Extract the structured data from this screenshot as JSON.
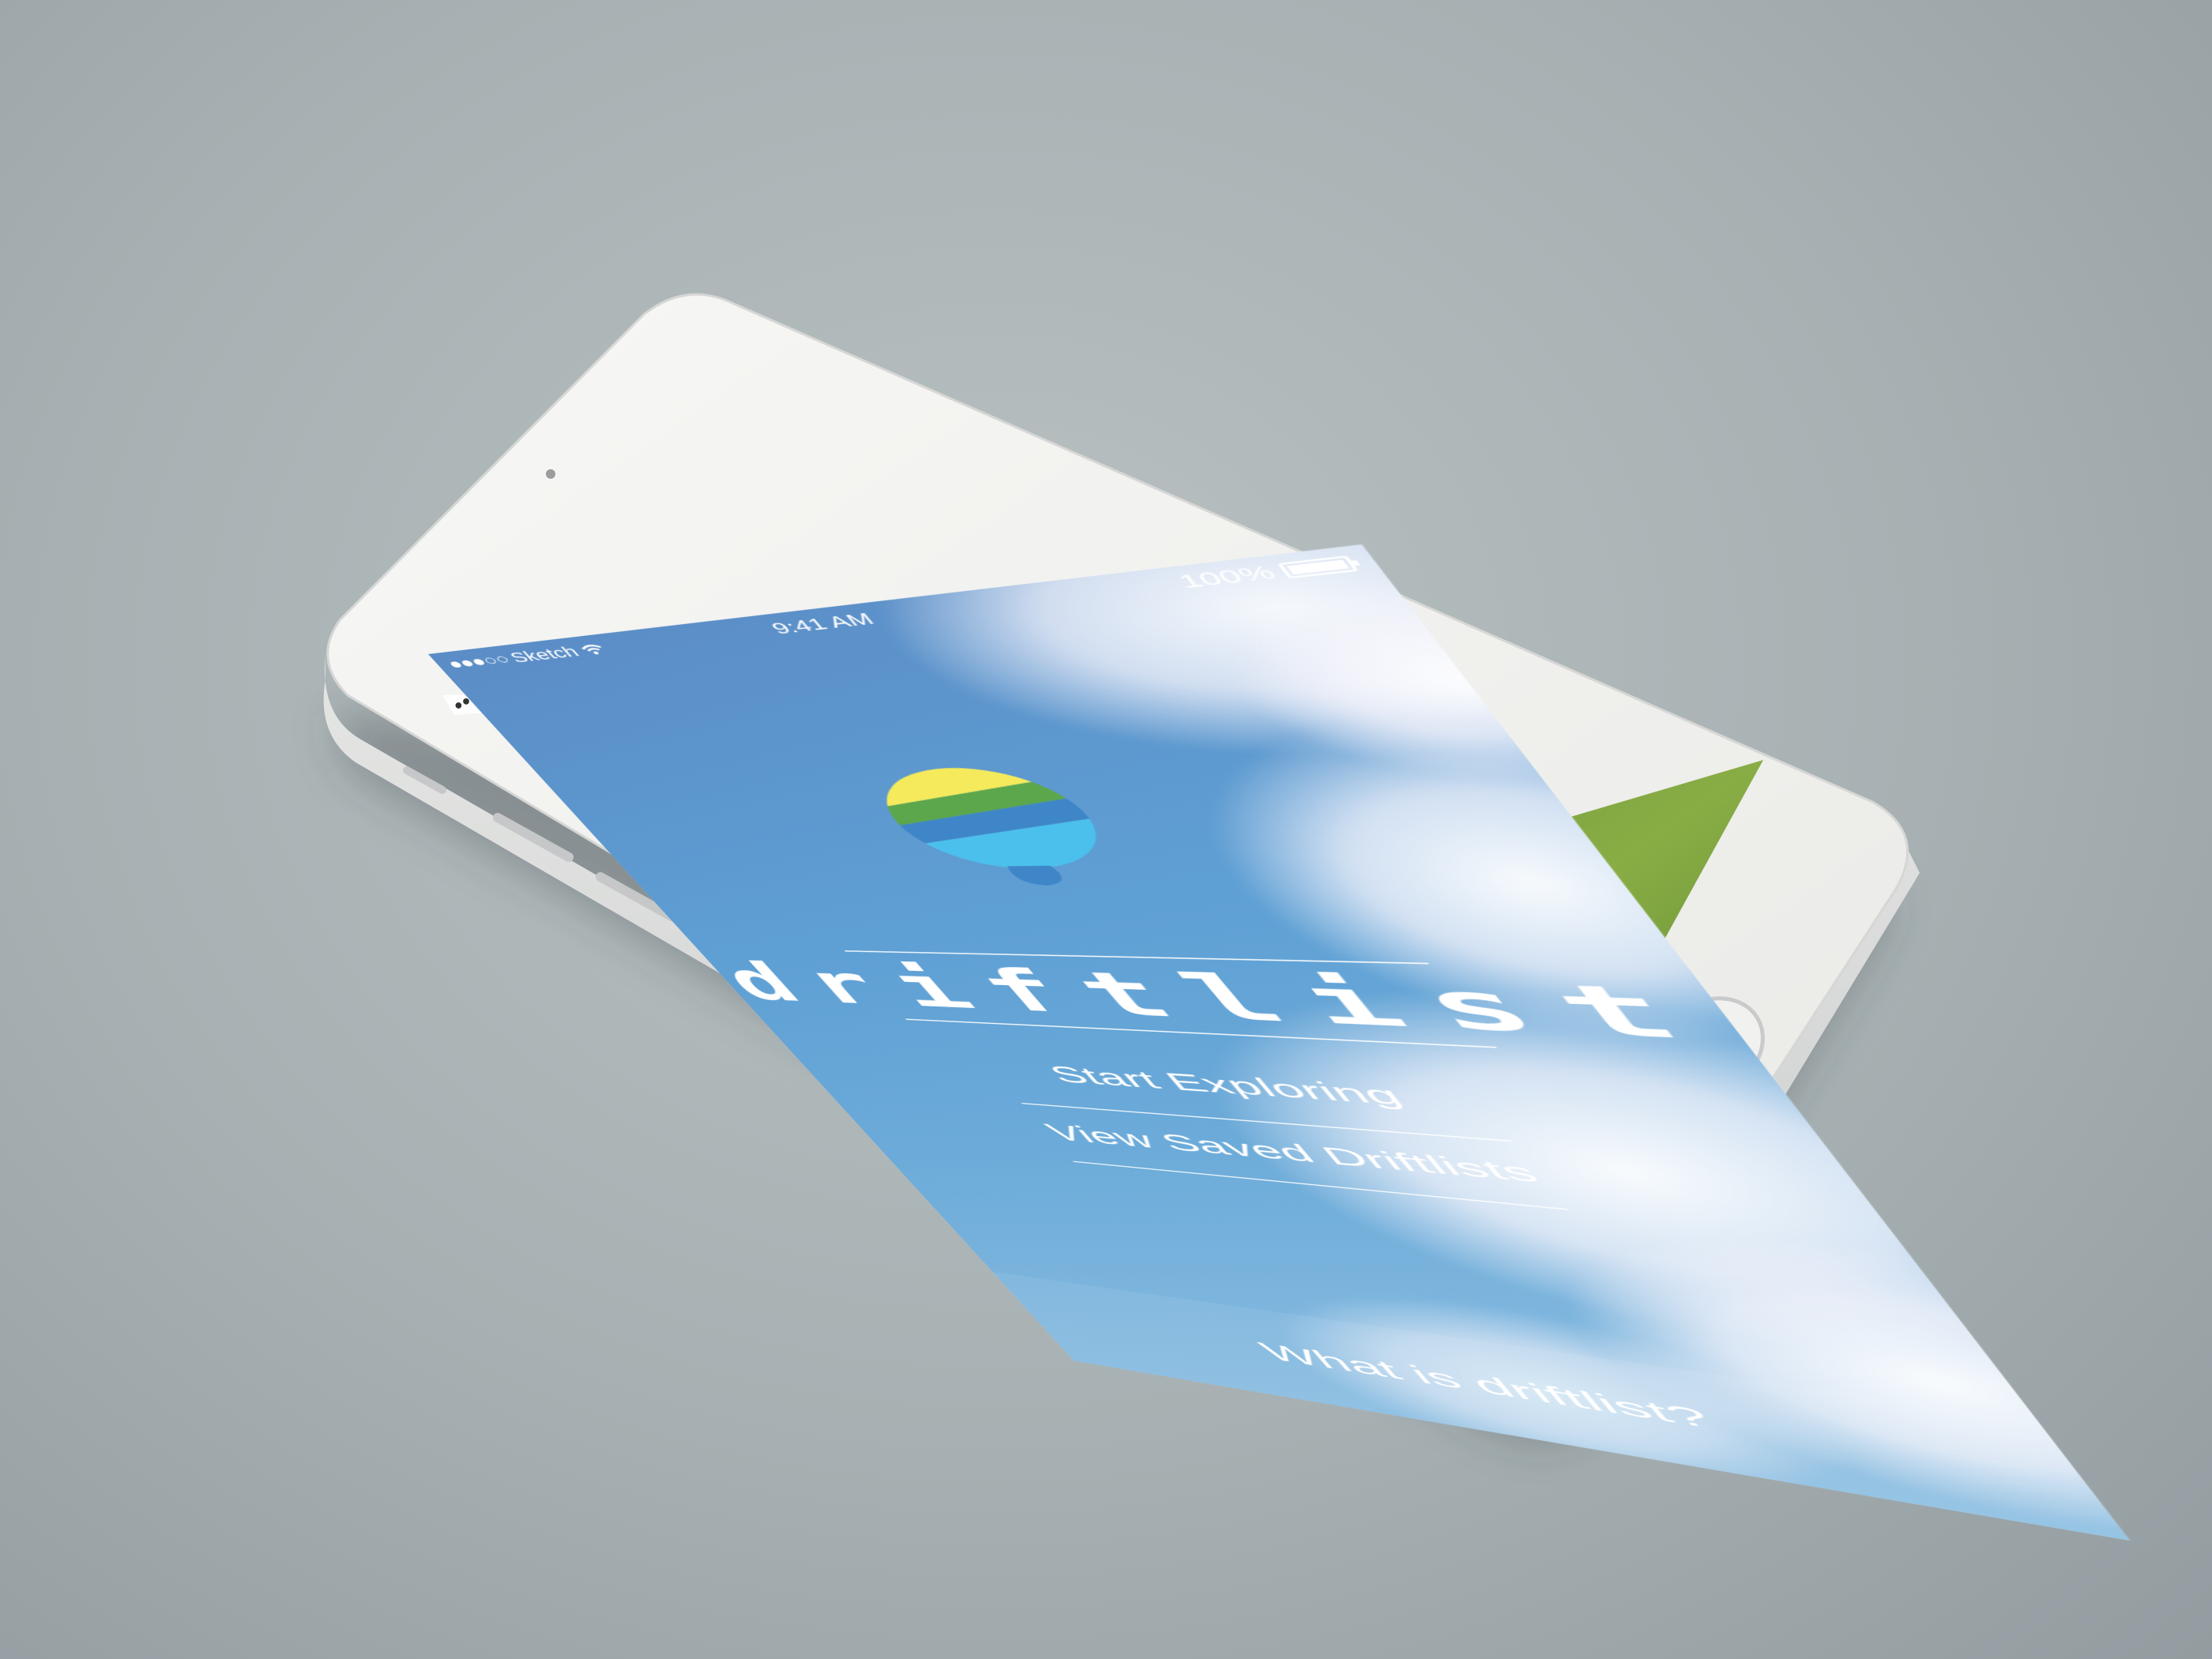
{
  "status_bar": {
    "carrier": "Sketch",
    "time": "9:41 AM",
    "battery": "100%"
  },
  "app": {
    "brand": "driftlist",
    "menu": {
      "start": "Start Exploring",
      "saved": "View Saved Driftlists"
    },
    "about": "What is driftlist?"
  },
  "colors": {
    "background": "#a7b0b2",
    "sky": "#5e9fd4",
    "logo_yellow": "#f4ea5c",
    "logo_green": "#5ca74b",
    "logo_blue": "#3f86c8",
    "logo_light_blue": "#4cc0ec"
  },
  "icons": [
    "signal-icon",
    "wifi-icon",
    "battery-icon",
    "balloon-logo-icon",
    "back-chevron-icon",
    "home-button-icon"
  ]
}
